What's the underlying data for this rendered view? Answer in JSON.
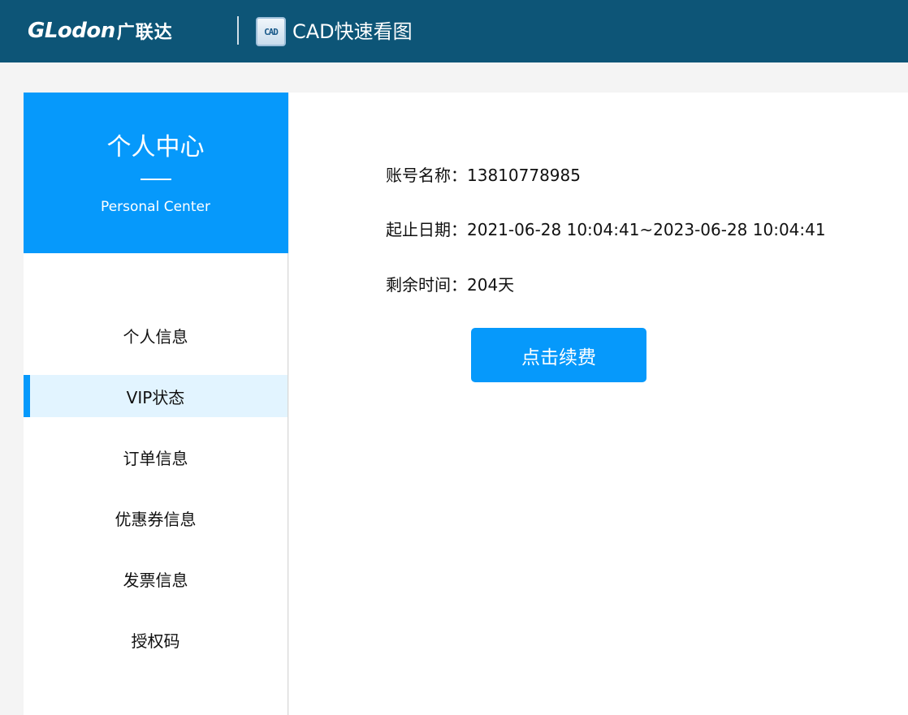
{
  "header": {
    "brand_en": "GLodon",
    "brand_cn": "广联达",
    "app_icon_text": "CAD",
    "app_name": "CAD快速看图",
    "background": "#0d5577"
  },
  "sidebar": {
    "title": "个人中心",
    "subtitle": "Personal Center",
    "accent": "#0699fb",
    "items": [
      {
        "label": "个人信息",
        "active": false
      },
      {
        "label": "VIP状态",
        "active": true
      },
      {
        "label": "订单信息",
        "active": false
      },
      {
        "label": "优惠券信息",
        "active": false
      },
      {
        "label": "发票信息",
        "active": false
      },
      {
        "label": "授权码",
        "active": false
      }
    ]
  },
  "vip": {
    "account_label": "账号名称：",
    "account_value": "13810778985",
    "period_label": "起止日期：",
    "period_value": "2021-06-28 10:04:41~2023-06-28 10:04:41",
    "remaining_label": "剩余时间：",
    "remaining_value": "204天",
    "renew_button": "点击续费"
  }
}
